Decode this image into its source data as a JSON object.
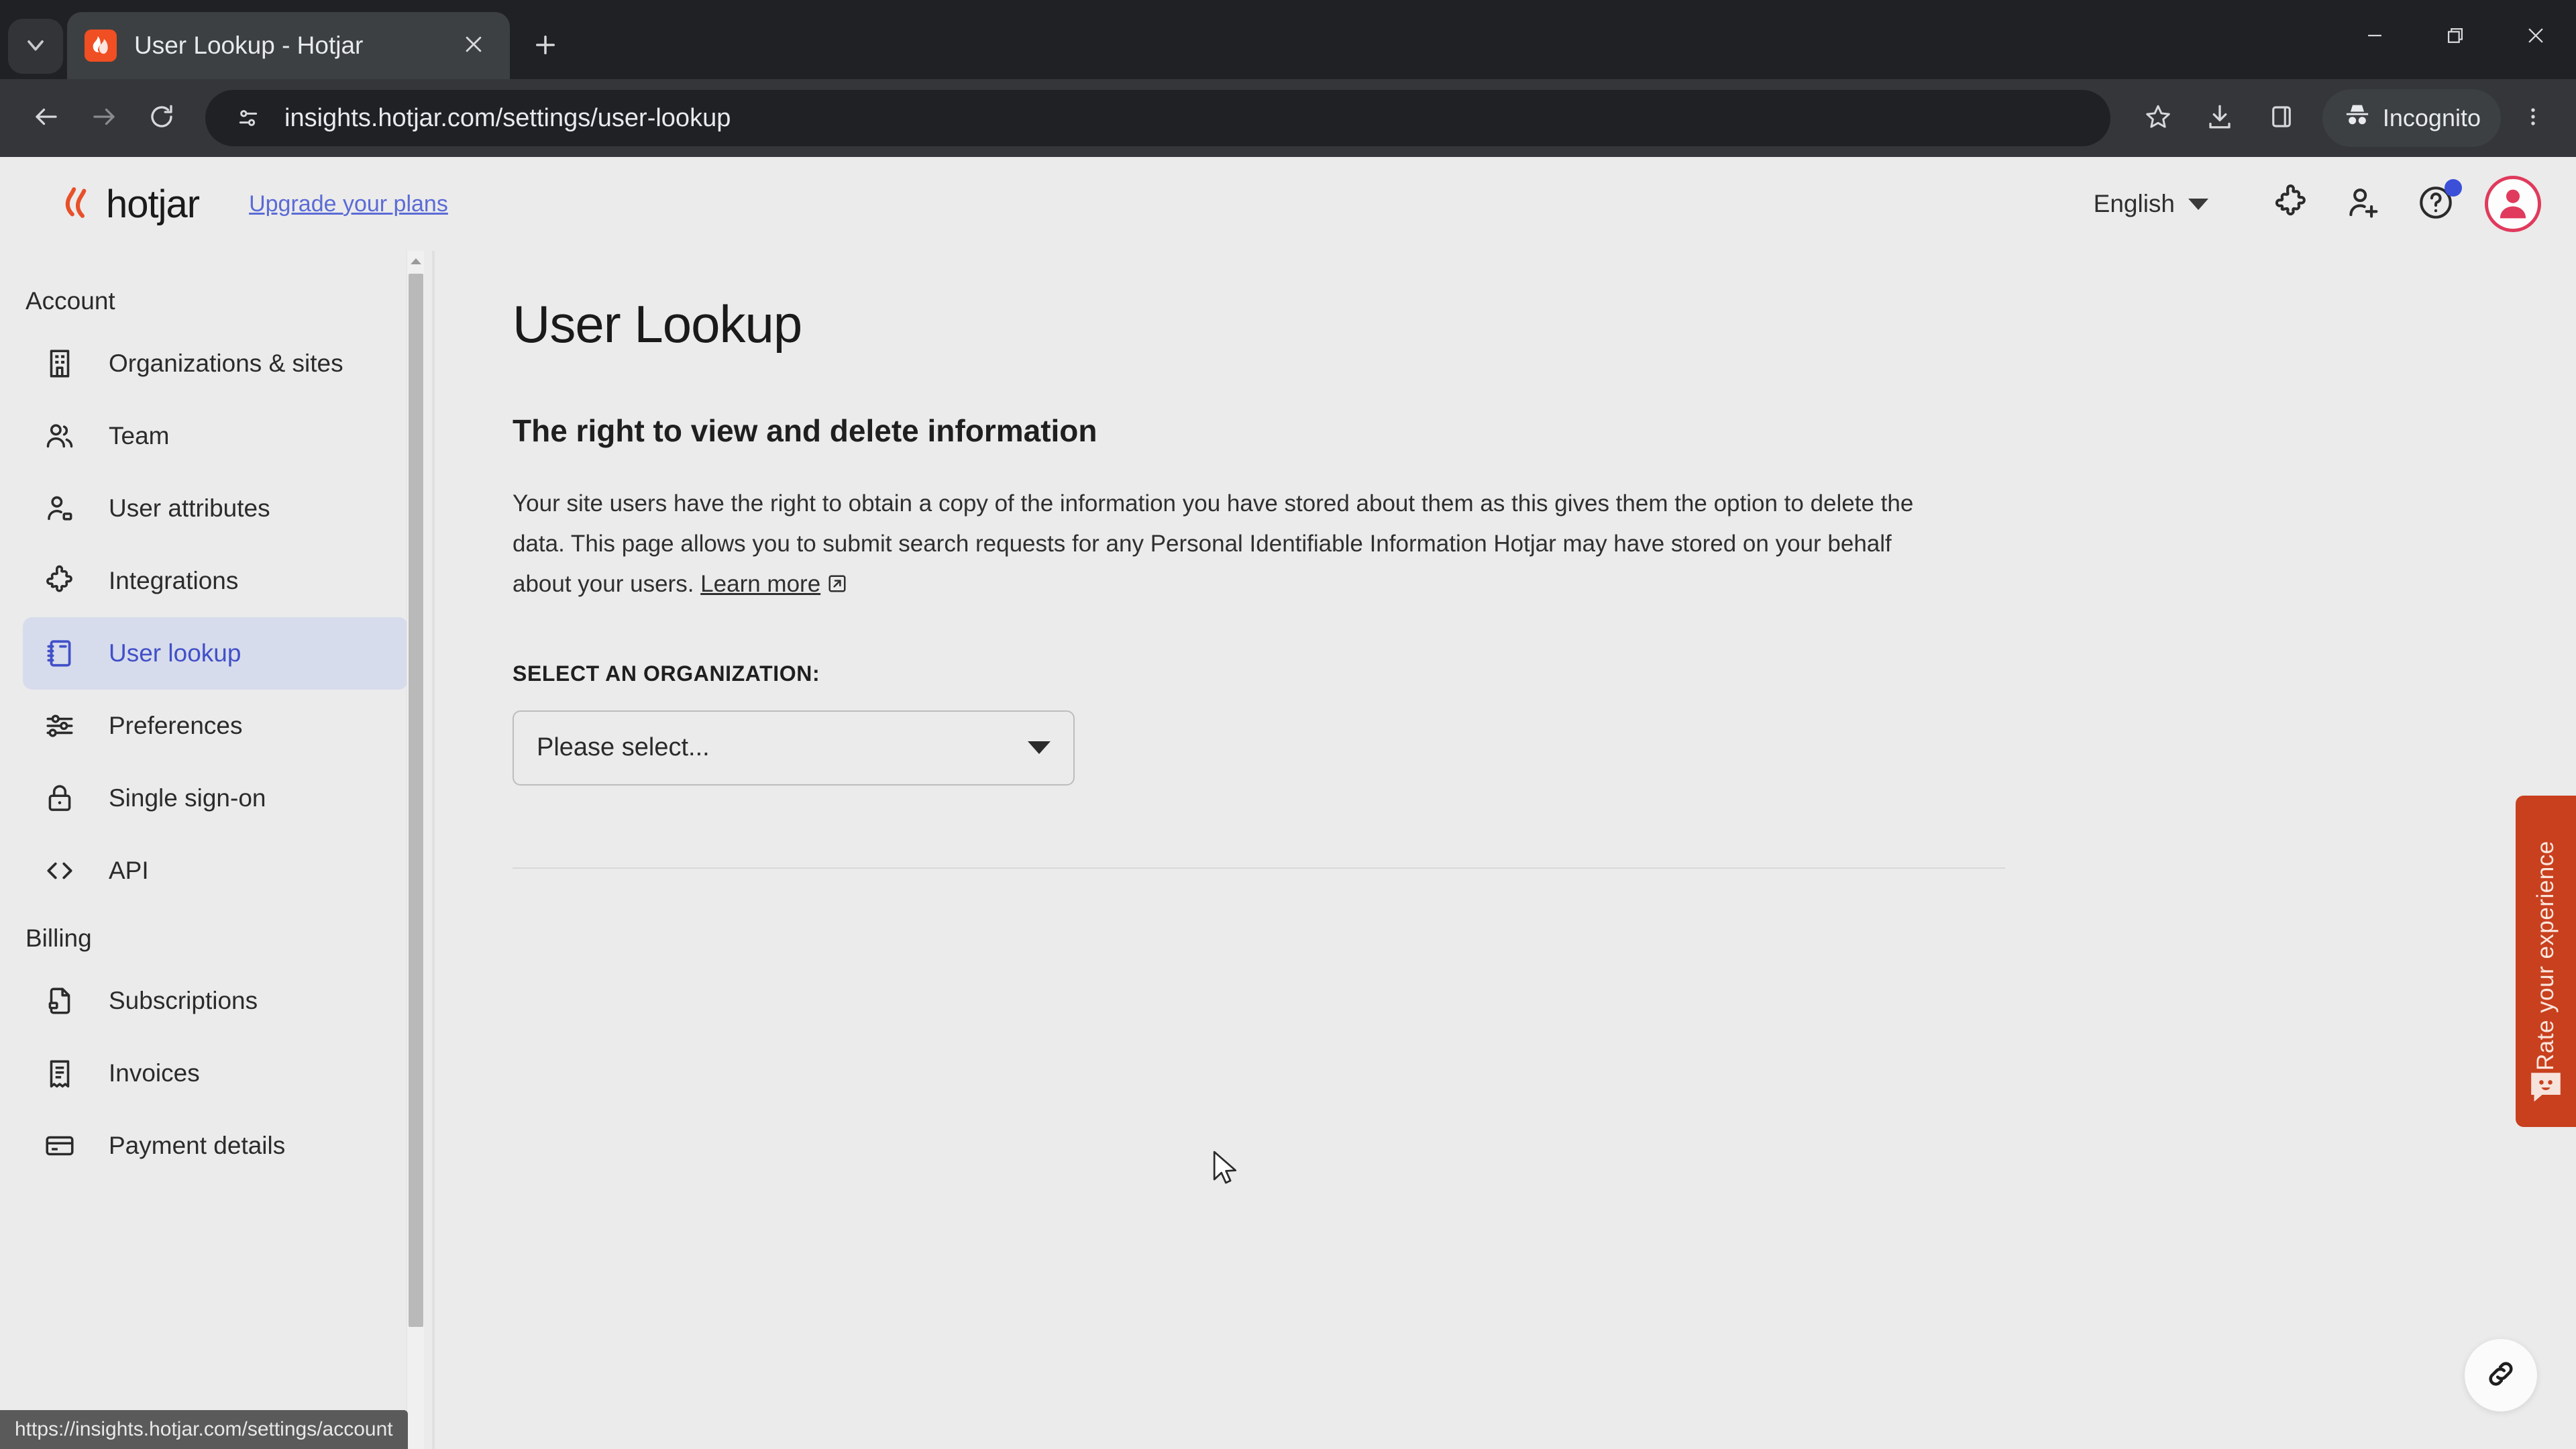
{
  "browser": {
    "tab": {
      "title": "User Lookup - Hotjar",
      "favicon_icon": "hotjar-flame-icon",
      "close_icon": "close-icon"
    },
    "tab_list_icon": "chevron-down-icon",
    "new_tab_icon": "plus-icon",
    "window_controls": {
      "minimize_icon": "minimize-icon",
      "maximize_icon": "maximize-restore-icon",
      "close_icon": "window-close-icon"
    },
    "toolbar": {
      "back_icon": "arrow-left-icon",
      "forward_icon": "arrow-right-icon",
      "reload_icon": "reload-icon",
      "site_info_icon": "page-settings-icon",
      "url": "insights.hotjar.com/settings/user-lookup",
      "bookmark_icon": "star-icon",
      "downloads_icon": "download-icon",
      "side_panel_icon": "side-panel-icon",
      "incognito_label": "Incognito",
      "incognito_icon": "incognito-hat-icon",
      "menu_icon": "three-dot-menu-icon"
    },
    "status_url": "https://insights.hotjar.com/settings/account"
  },
  "app_header": {
    "brand_name": "hotjar",
    "brand_icon": "hotjar-flame-icon",
    "upgrade_link": "Upgrade your plans",
    "language": "English",
    "language_caret_icon": "chevron-down-icon",
    "icons": {
      "integrations": "puzzle-piece-icon",
      "invite_user": "add-user-icon",
      "help": "help-question-icon",
      "avatar": "user-avatar-icon"
    },
    "help_badge": true
  },
  "sidebar": {
    "groups": [
      {
        "label": "Account",
        "items": [
          {
            "label": "Organizations & sites",
            "icon": "building-icon",
            "active": false
          },
          {
            "label": "Team",
            "icon": "users-group-icon",
            "active": false
          },
          {
            "label": "User attributes",
            "icon": "user-tag-icon",
            "active": false
          },
          {
            "label": "Integrations",
            "icon": "puzzle-piece-icon",
            "active": false
          },
          {
            "label": "User lookup",
            "icon": "notebook-icon",
            "active": true
          },
          {
            "label": "Preferences",
            "icon": "sliders-icon",
            "active": false
          },
          {
            "label": "Single sign-on",
            "icon": "lock-icon",
            "active": false
          },
          {
            "label": "API",
            "icon": "code-brackets-icon",
            "active": false
          }
        ]
      },
      {
        "label": "Billing",
        "items": [
          {
            "label": "Subscriptions",
            "icon": "document-lock-icon",
            "active": false
          },
          {
            "label": "Invoices",
            "icon": "receipt-icon",
            "active": false
          },
          {
            "label": "Payment details",
            "icon": "credit-card-icon",
            "active": false
          }
        ]
      }
    ],
    "scrollbar_up_icon": "scroll-up-arrow-icon"
  },
  "main": {
    "page_title": "User Lookup",
    "section_title": "The right to view and delete information",
    "body_text": "Your site users have the right to obtain a copy of the information you have stored about them as this gives them the option to delete the data. This page allows you to submit search requests for any Personal Identifiable Information Hotjar may have stored on your behalf about your users.",
    "learn_more_label": "Learn more",
    "learn_more_icon": "external-link-icon",
    "field_label": "SELECT AN ORGANIZATION:",
    "select_value": "Please select...",
    "select_caret_icon": "caret-down-icon"
  },
  "widgets": {
    "rate_tab_label": "Rate your experience",
    "rate_tab_icon": "smiley-speech-bubble-icon",
    "rate_tab_color": "#c8401e",
    "link_fab_icon": "chain-link-icon"
  },
  "colors": {
    "accent_blue": "#4150c8",
    "active_item_bg": "#d7dcec",
    "brand_red": "#f04e23",
    "page_bg": "#ebebeb",
    "chrome_dark": "#202124"
  }
}
